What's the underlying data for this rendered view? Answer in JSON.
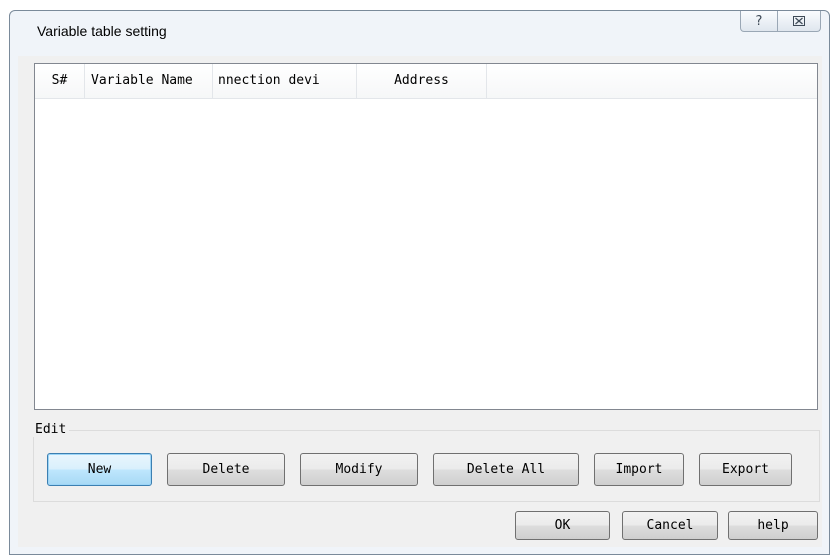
{
  "window": {
    "title": "Variable table setting",
    "help_glyph": "?",
    "close_glyph": "⊠"
  },
  "table": {
    "columns": [
      "S#",
      "Variable Name",
      "nnection devi",
      "Address"
    ],
    "rows": []
  },
  "edit_group": {
    "label": "Edit",
    "buttons": {
      "new": "New",
      "delete": "Delete",
      "modify": "Modify",
      "delete_all": "Delete All",
      "import": "Import",
      "export": "Export"
    }
  },
  "footer": {
    "ok": "OK",
    "cancel": "Cancel",
    "help": "help"
  }
}
